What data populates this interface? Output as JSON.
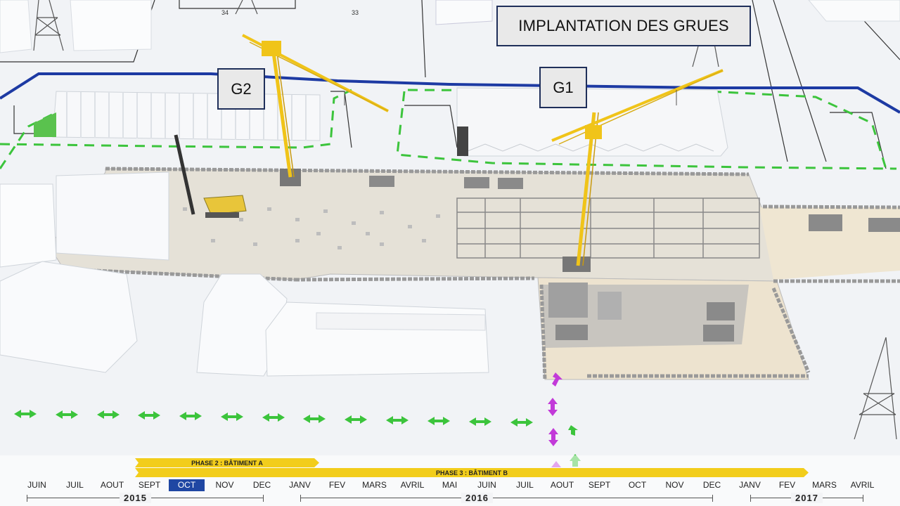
{
  "title": "IMPLANTATION DES GRUES",
  "cranes": [
    {
      "label": "G2"
    },
    {
      "label": "G1"
    }
  ],
  "parcel_numbers": [
    "34",
    "33"
  ],
  "timeline": {
    "phases": [
      {
        "num": "PHASE 2",
        "desc": "BÂTIMENT A"
      },
      {
        "num": "PHASE 3",
        "desc": "BÂTIMENT B"
      }
    ],
    "months": [
      "JUIN",
      "JUIL",
      "AOUT",
      "SEPT",
      "OCT",
      "NOV",
      "DEC",
      "JANV",
      "FEV",
      "MARS",
      "AVRIL",
      "MAI",
      "JUIN",
      "JUIL",
      "AOUT",
      "SEPT",
      "OCT",
      "NOV",
      "DEC",
      "JANV",
      "FEV",
      "MARS",
      "AVRIL"
    ],
    "current_month_index": 4,
    "years": [
      "2015",
      "2016",
      "2017"
    ]
  },
  "colors": {
    "frame": "#1f2f5a",
    "crane": "#f0c419",
    "arrow_green": "#3cc43c",
    "arrow_purple": "#c23ad9",
    "phase_bar": "#f2cd1b",
    "current_month": "#1f47a3"
  }
}
